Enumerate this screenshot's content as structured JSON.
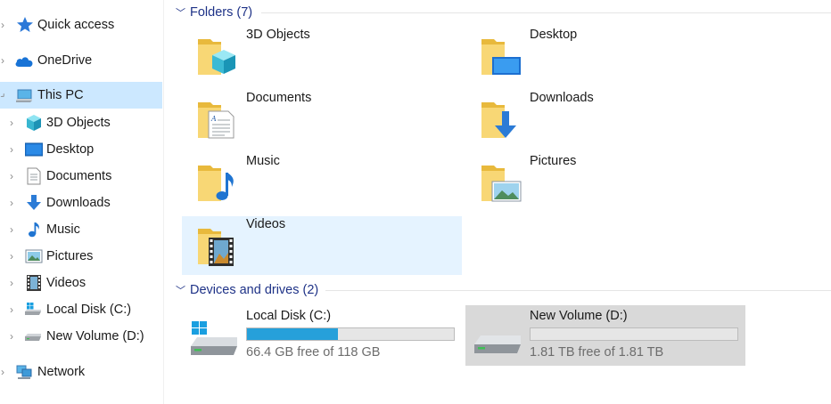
{
  "nav": {
    "items": [
      {
        "label": "Quick access",
        "icon": "star-icon"
      },
      {
        "label": "OneDrive",
        "icon": "cloud-icon"
      },
      {
        "label": "This PC",
        "icon": "computer-icon",
        "selected": true,
        "expanded": true
      },
      {
        "label": "3D Objects",
        "icon": "cube-icon"
      },
      {
        "label": "Desktop",
        "icon": "desktop-icon"
      },
      {
        "label": "Documents",
        "icon": "document-icon"
      },
      {
        "label": "Downloads",
        "icon": "download-arrow-icon"
      },
      {
        "label": "Music",
        "icon": "music-note-icon"
      },
      {
        "label": "Pictures",
        "icon": "picture-icon"
      },
      {
        "label": "Videos",
        "icon": "film-icon"
      },
      {
        "label": "Local Disk (C:)",
        "icon": "windows-drive-icon"
      },
      {
        "label": "New Volume (D:)",
        "icon": "drive-icon"
      },
      {
        "label": "Network",
        "icon": "network-icon"
      }
    ]
  },
  "folders": {
    "header": "Folders (7)",
    "items": [
      {
        "label": "3D Objects",
        "icon": "folder-3d-objects-icon"
      },
      {
        "label": "Desktop",
        "icon": "folder-desktop-icon"
      },
      {
        "label": "Documents",
        "icon": "folder-documents-icon"
      },
      {
        "label": "Downloads",
        "icon": "folder-downloads-icon"
      },
      {
        "label": "Music",
        "icon": "folder-music-icon"
      },
      {
        "label": "Pictures",
        "icon": "folder-pictures-icon"
      },
      {
        "label": "Videos",
        "icon": "folder-videos-icon",
        "selected": true
      }
    ]
  },
  "drives": {
    "header": "Devices and drives (2)",
    "items": [
      {
        "name": "Local Disk (C:)",
        "free_text": "66.4 GB free of 118 GB",
        "used_fraction": 0.44,
        "icon": "windows-drive-icon"
      },
      {
        "name": "New Volume (D:)",
        "free_text": "1.81 TB free of 1.81 TB",
        "used_fraction": 0.0,
        "icon": "drive-icon",
        "selected": true
      }
    ]
  },
  "colors": {
    "accent": "#26a0da",
    "nav_selected": "#cce8ff",
    "tile_selected": "#e5f3ff",
    "drive_selected": "#d9d9d9",
    "group_header": "#1e3287",
    "folder_yellow": "#f8d775"
  }
}
